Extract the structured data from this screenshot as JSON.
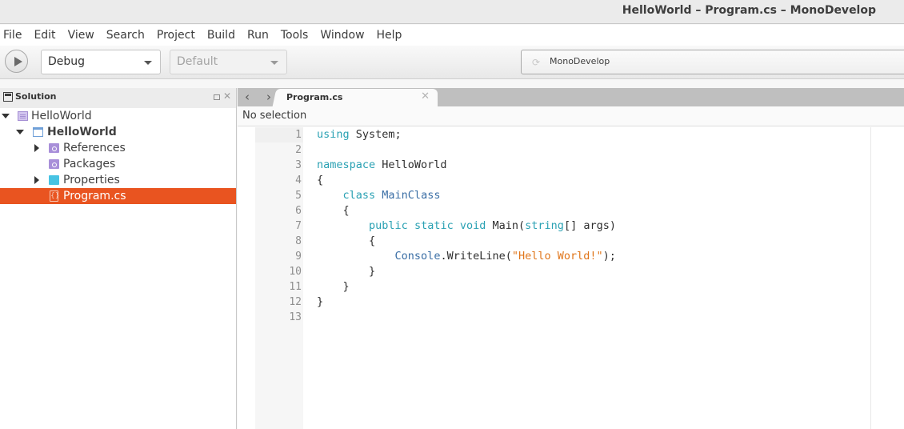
{
  "window": {
    "title": "HelloWorld – Program.cs – MonoDevelop"
  },
  "menubar": {
    "items": [
      "File",
      "Edit",
      "View",
      "Search",
      "Project",
      "Build",
      "Run",
      "Tools",
      "Window",
      "Help"
    ]
  },
  "toolbar": {
    "run_icon": "play-icon",
    "configuration": "Debug",
    "target": "Default",
    "status_message": "MonoDevelop",
    "status_icon": "spinner-icon"
  },
  "solution_pad": {
    "title": "Solution",
    "tree": [
      {
        "label": "HelloWorld",
        "type": "solution",
        "expanded": true,
        "depth": 0
      },
      {
        "label": "HelloWorld",
        "type": "project",
        "expanded": true,
        "depth": 1,
        "bold": true
      },
      {
        "label": "References",
        "type": "references-folder",
        "expanded": false,
        "depth": 2
      },
      {
        "label": "Packages",
        "type": "packages-folder",
        "depth": 2
      },
      {
        "label": "Properties",
        "type": "folder",
        "expanded": false,
        "depth": 2
      },
      {
        "label": "Program.cs",
        "type": "csharp-file",
        "depth": 2,
        "selected": true
      }
    ],
    "selection_color": "#e95420"
  },
  "editor": {
    "tabs": [
      {
        "label": "Program.cs",
        "active": true
      }
    ],
    "path_bar": "No selection",
    "lines": [
      {
        "n": "1",
        "tokens": [
          [
            "kw",
            "using"
          ],
          [
            "",
            " System;"
          ]
        ]
      },
      {
        "n": "2",
        "tokens": []
      },
      {
        "n": "3",
        "tokens": [
          [
            "kw",
            "namespace"
          ],
          [
            "",
            " HelloWorld"
          ]
        ]
      },
      {
        "n": "4",
        "tokens": [
          [
            "",
            "{"
          ]
        ]
      },
      {
        "n": "5",
        "tokens": [
          [
            "",
            "    "
          ],
          [
            "kw",
            "class"
          ],
          [
            "",
            " "
          ],
          [
            "ty",
            "MainClass"
          ]
        ]
      },
      {
        "n": "6",
        "tokens": [
          [
            "",
            "    {"
          ]
        ]
      },
      {
        "n": "7",
        "tokens": [
          [
            "",
            "        "
          ],
          [
            "kw",
            "public"
          ],
          [
            "",
            " "
          ],
          [
            "kw",
            "static"
          ],
          [
            "",
            " "
          ],
          [
            "kw",
            "void"
          ],
          [
            "",
            " Main("
          ],
          [
            "kw",
            "string"
          ],
          [
            "",
            "[] args)"
          ]
        ]
      },
      {
        "n": "8",
        "tokens": [
          [
            "",
            "        {"
          ]
        ]
      },
      {
        "n": "9",
        "tokens": [
          [
            "",
            "            "
          ],
          [
            "ty",
            "Console"
          ],
          [
            "",
            ".WriteLine("
          ],
          [
            "str",
            "\"Hello World!\""
          ],
          [
            "",
            ");"
          ]
        ]
      },
      {
        "n": "10",
        "tokens": [
          [
            "",
            "        }"
          ]
        ]
      },
      {
        "n": "11",
        "tokens": [
          [
            "",
            "    }"
          ]
        ]
      },
      {
        "n": "12",
        "tokens": [
          [
            "",
            "}"
          ]
        ]
      },
      {
        "n": "13",
        "tokens": []
      }
    ],
    "colors": {
      "keyword": "#2aa1b3",
      "type": "#3a6ea5",
      "string": "#e0761b"
    }
  }
}
